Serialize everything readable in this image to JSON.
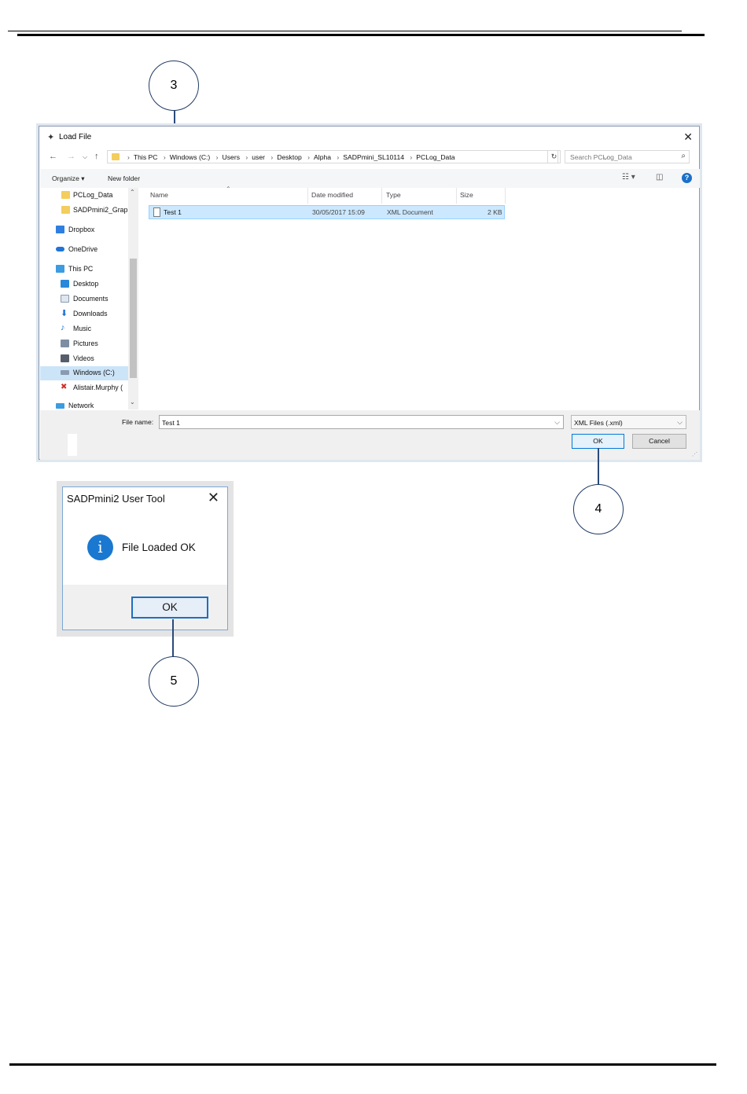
{
  "callouts": {
    "c3": "3",
    "c4": "4",
    "c5": "5"
  },
  "load_dialog": {
    "title": "Load File",
    "breadcrumbs": [
      "This PC",
      "Windows (C:)",
      "Users",
      "user",
      "Desktop",
      "Alpha",
      "SADPmini_SL10114",
      "PCLog_Data"
    ],
    "search_placeholder": "Search PCLog_Data",
    "toolbar": {
      "organize": "Organize ▾",
      "new_folder": "New folder"
    },
    "nav_items": [
      {
        "label": "PCLog_Data",
        "icon": "folder-icon"
      },
      {
        "label": "SADPmini2_Grap",
        "icon": "folder-icon"
      },
      {
        "label": "Dropbox",
        "icon": "dropbox-icon"
      },
      {
        "label": "OneDrive",
        "icon": "onedrive-icon"
      },
      {
        "label": "This PC",
        "icon": "computer-icon"
      },
      {
        "label": "Desktop",
        "icon": "desktop-icon"
      },
      {
        "label": "Documents",
        "icon": "documents-icon"
      },
      {
        "label": "Downloads",
        "icon": "downloads-icon"
      },
      {
        "label": "Music",
        "icon": "music-icon"
      },
      {
        "label": "Pictures",
        "icon": "pictures-icon"
      },
      {
        "label": "Videos",
        "icon": "videos-icon"
      },
      {
        "label": "Windows (C:)",
        "icon": "drive-icon"
      },
      {
        "label": "Alistair.Murphy (",
        "icon": "network-drive-icon"
      },
      {
        "label": "Network",
        "icon": "network-icon"
      }
    ],
    "columns": {
      "name": "Name",
      "date": "Date modified",
      "type": "Type",
      "size": "Size"
    },
    "files": [
      {
        "name": "Test 1",
        "date": "30/05/2017 15:09",
        "type": "XML Document",
        "size": "2 KB"
      }
    ],
    "file_name_label": "File name:",
    "file_name_value": "Test 1",
    "file_type": "XML Files (.xml)",
    "ok_label": "OK",
    "cancel_label": "Cancel"
  },
  "message_box": {
    "title": "SADPmini2 User Tool",
    "message": "File Loaded OK",
    "ok_label": "OK"
  },
  "colors": {
    "accent": "#0078d7",
    "selection": "#cce8ff",
    "callout_border": "#1f3a64",
    "info_icon": "#1a78d0"
  }
}
